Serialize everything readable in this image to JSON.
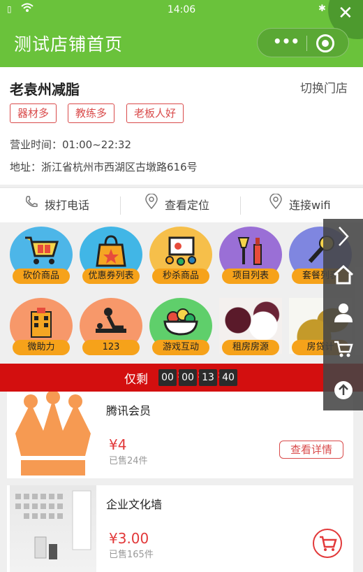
{
  "status_bar": {
    "time": "14:06"
  },
  "nav": {
    "title": "测试店铺首页"
  },
  "store": {
    "name": "老袁州减脂",
    "switch_label": "切换门店",
    "tags": [
      "器材多",
      "教练多",
      "老板人好"
    ],
    "hours": "营业时间：01:00~22:32",
    "address": "地址：浙江省杭州市西湖区古墩路616号"
  },
  "actions": [
    {
      "label": "拨打电话",
      "icon": "phone-icon"
    },
    {
      "label": "查看定位",
      "icon": "location-pin-icon"
    },
    {
      "label": "连接wifi",
      "icon": "location-pin-icon"
    }
  ],
  "grid": [
    {
      "label": "砍价商品",
      "icon": "shopping-cart-icon",
      "color": "#4db6e8"
    },
    {
      "label": "优惠券列表",
      "icon": "shopping-bag-icon",
      "color": "#41b6e6"
    },
    {
      "label": "秒杀商品",
      "icon": "presentation-icon",
      "color": "#f6bf4a"
    },
    {
      "label": "项目列表",
      "icon": "makeup-icon",
      "color": "#9a6fd6"
    },
    {
      "label": "套餐列表",
      "icon": "microphone-icon",
      "color": "#7f86e0"
    },
    {
      "label": "微助力",
      "icon": "hotel-icon",
      "color": "#f7986a"
    },
    {
      "label": "123",
      "icon": "massage-icon",
      "color": "#f7986a"
    },
    {
      "label": "游戏互动",
      "icon": "fruit-bowl-icon",
      "color": "#5fcf6b"
    },
    {
      "label": "租房房源",
      "icon": "mangosteen-photo",
      "color": "#ffffff"
    },
    {
      "label": "房贷计",
      "icon": "pineapple-photo",
      "color": "#ffffff"
    }
  ],
  "countdown": {
    "label": "仅剩",
    "hours": "00",
    "minutes": "00",
    "seconds": "13",
    "fraction": "40"
  },
  "products": [
    {
      "title": "腾讯会员",
      "price": "¥4",
      "sold": "已售24件",
      "detail_label": "查看详情",
      "image": "crown-icon"
    },
    {
      "title": "企业文化墙",
      "price": "¥3.00",
      "sold": "已售165件",
      "image": "culture-wall-photo",
      "cart_icon": "cart-icon"
    }
  ],
  "float_panel": [
    "chevron-right-icon",
    "home-icon",
    "user-icon",
    "cart-icon",
    "arrow-up-icon"
  ]
}
